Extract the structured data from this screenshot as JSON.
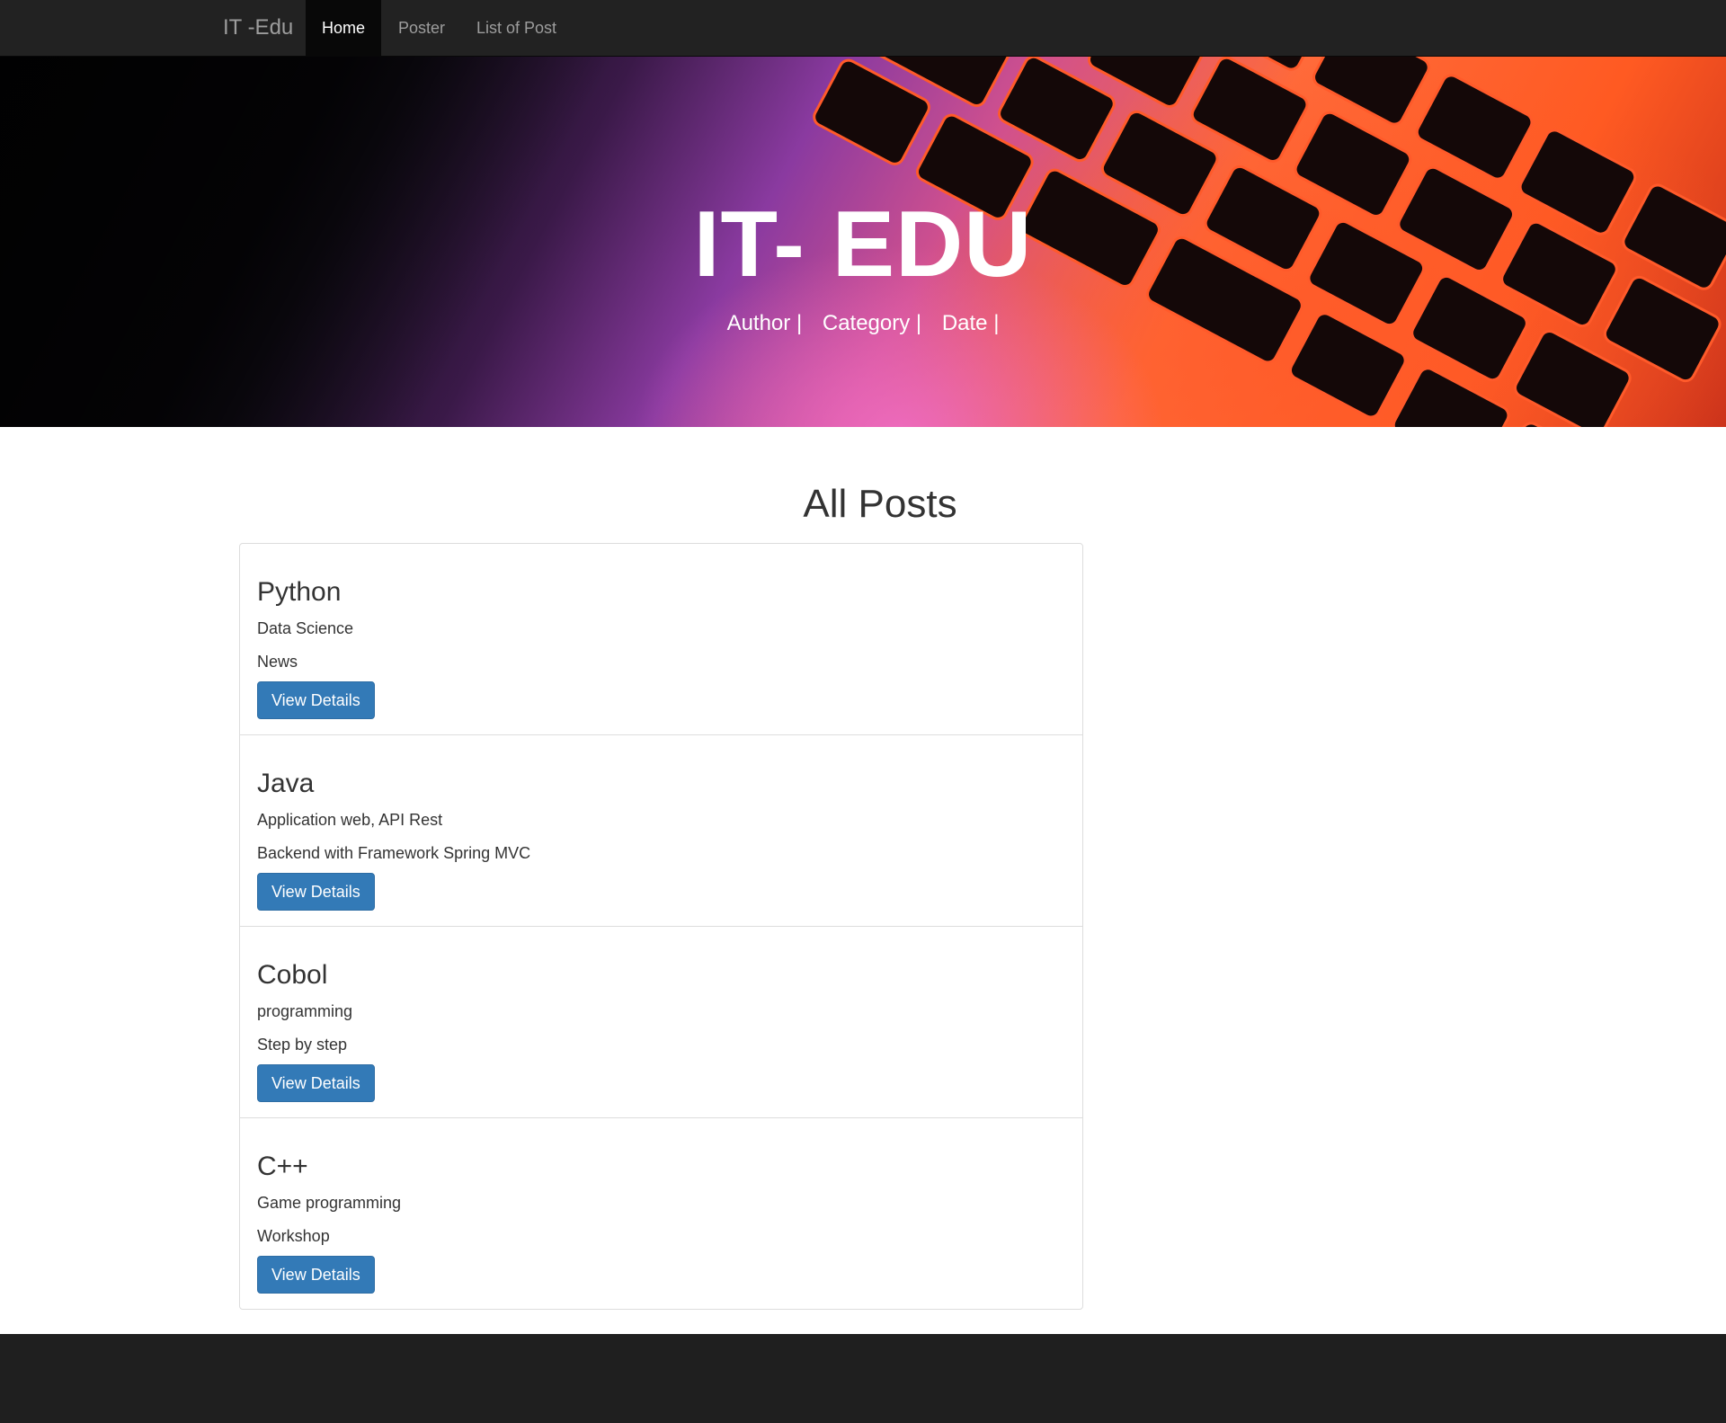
{
  "navbar": {
    "brand": "IT -Edu",
    "items": [
      {
        "label": "Home",
        "active": true
      },
      {
        "label": "Poster",
        "active": false
      },
      {
        "label": "List of Post",
        "active": false
      }
    ]
  },
  "hero": {
    "title": "IT- EDU",
    "meta": [
      "Author |",
      "Category |",
      "Date |"
    ]
  },
  "main": {
    "title": "All Posts",
    "button_label": "View Details",
    "posts": [
      {
        "title": "Python",
        "line1": "Data Science",
        "line2": "News"
      },
      {
        "title": "Java",
        "line1": "Application web, API Rest",
        "line2": "Backend with Framework Spring MVC"
      },
      {
        "title": "Cobol",
        "line1": "programming",
        "line2": "Step by step"
      },
      {
        "title": "C++",
        "line1": "Game programming",
        "line2": "Workshop"
      }
    ]
  },
  "colors": {
    "navbar": "#222222",
    "button": "#337ab7",
    "footer": "#1f1f1f"
  }
}
